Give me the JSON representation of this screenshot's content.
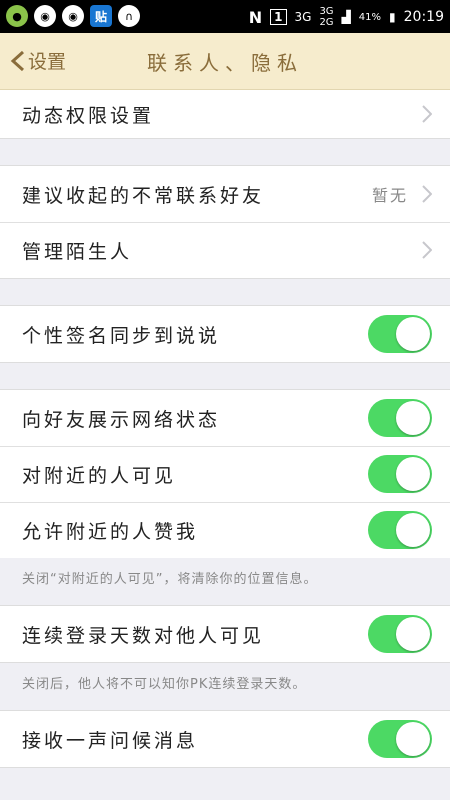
{
  "status_bar": {
    "icons": [
      "app-icon",
      "wechat-icon",
      "wechat-icon",
      "tieba-icon",
      "headphone-icon"
    ],
    "tieba_label": "贴",
    "network_3g_a": "3G",
    "network_3g_b": "3G",
    "network_2g": "2G",
    "sim_label": "1",
    "battery": "41%",
    "time": "20:19"
  },
  "nav": {
    "back_label": "设置",
    "title": "联系人、隐私"
  },
  "sections": {
    "s0": {
      "row0": "动态权限设置"
    },
    "s1": {
      "row0": "建议收起的不常联系好友",
      "row0_value": "暂无",
      "row1": "管理陌生人"
    },
    "s2": {
      "row0": "个性签名同步到说说"
    },
    "s3": {
      "row0": "向好友展示网络状态",
      "row1": "对附近的人可见",
      "row2": "允许附近的人赞我",
      "note": "关闭“对附近的人可见”，将清除你的位置信息。"
    },
    "s4": {
      "row0": "连续登录天数对他人可见",
      "note": "关闭后，他人将不可以知你PK连续登录天数。"
    },
    "s5": {
      "row0": "接收一声问候消息"
    }
  },
  "toggles": {
    "signature_sync": true,
    "show_network_status": true,
    "visible_to_nearby": true,
    "allow_nearby_like": true,
    "login_days_visible": true,
    "receive_greeting": true
  },
  "colors": {
    "nav_bg": "#f6eccd",
    "nav_text": "#8a6d3b",
    "toggle_on": "#4cd964",
    "page_bg": "#efeff4"
  }
}
